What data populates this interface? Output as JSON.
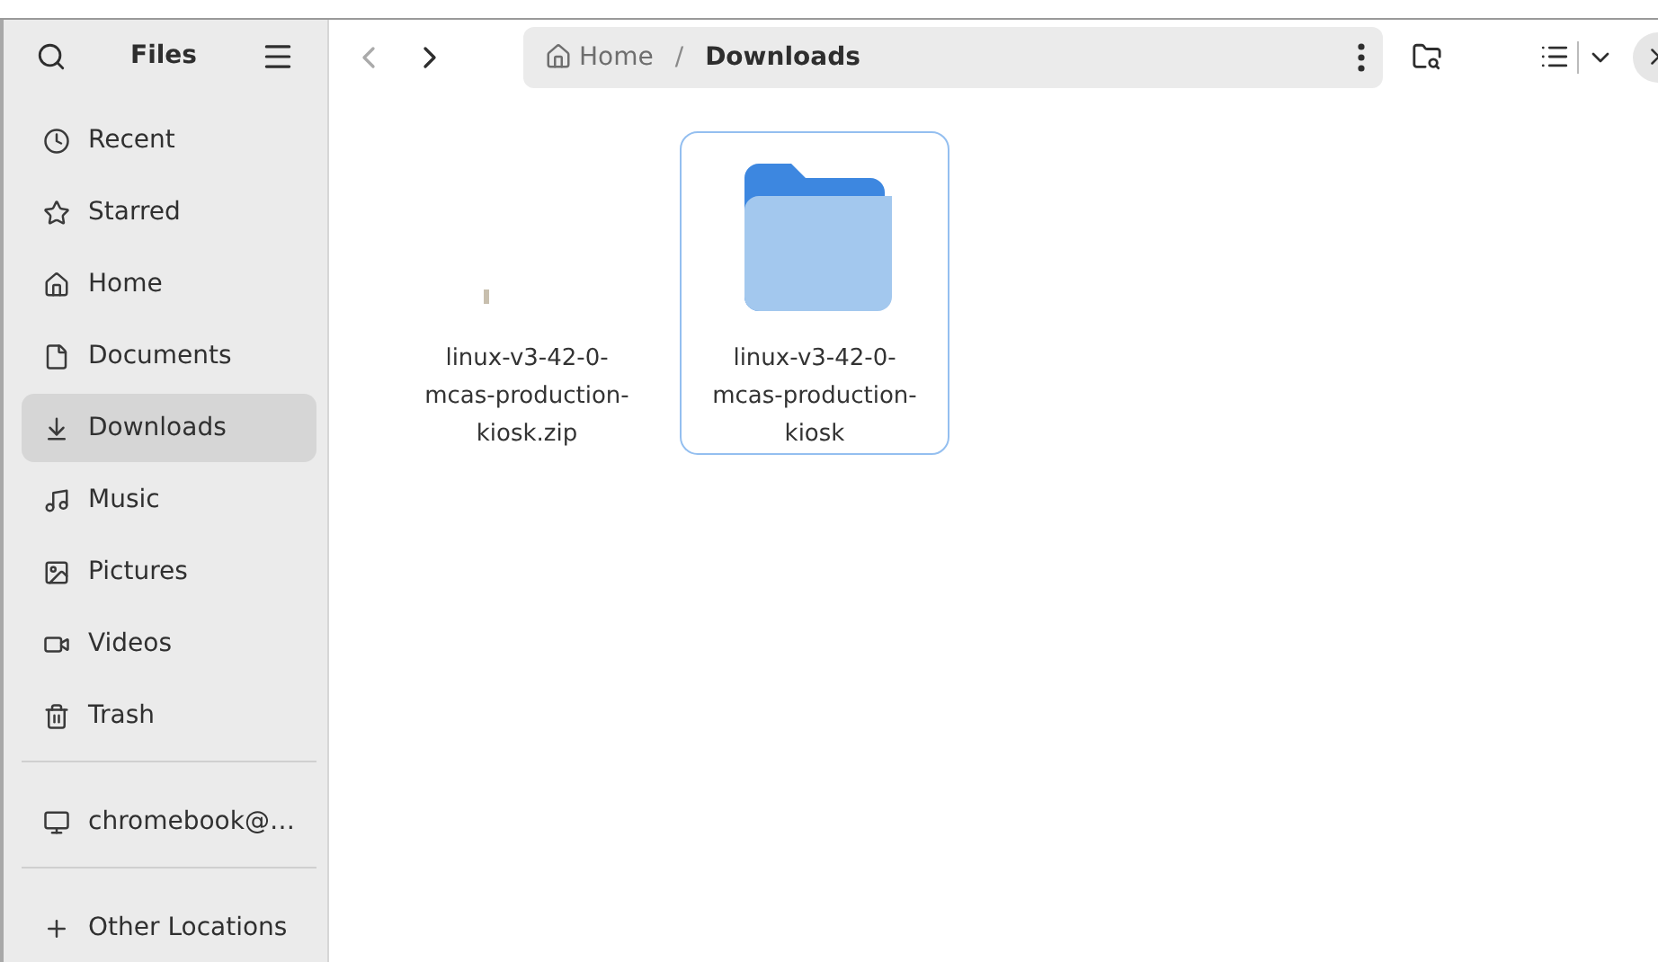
{
  "sidebar": {
    "title": "Files",
    "sections": [
      [
        {
          "label": "Recent",
          "selected": false
        },
        {
          "label": "Starred",
          "selected": false
        },
        {
          "label": "Home",
          "selected": false
        },
        {
          "label": "Documents",
          "selected": false
        },
        {
          "label": "Downloads",
          "selected": true
        },
        {
          "label": "Music",
          "selected": false
        },
        {
          "label": "Pictures",
          "selected": false
        },
        {
          "label": "Videos",
          "selected": false
        },
        {
          "label": "Trash",
          "selected": false
        }
      ],
      [
        {
          "label": "chromebook@…",
          "selected": false
        }
      ],
      [
        {
          "label": "Other Locations",
          "selected": false
        }
      ]
    ]
  },
  "path": [
    "Home",
    "Downloads"
  ],
  "path_separator": "/",
  "files": [
    {
      "name": "linux-v3-42-0-mcas-production-kiosk.zip",
      "kind": "archive",
      "selected": false
    },
    {
      "name": "linux-v3-42-0-mcas-production-kiosk",
      "kind": "folder",
      "selected": true
    }
  ]
}
